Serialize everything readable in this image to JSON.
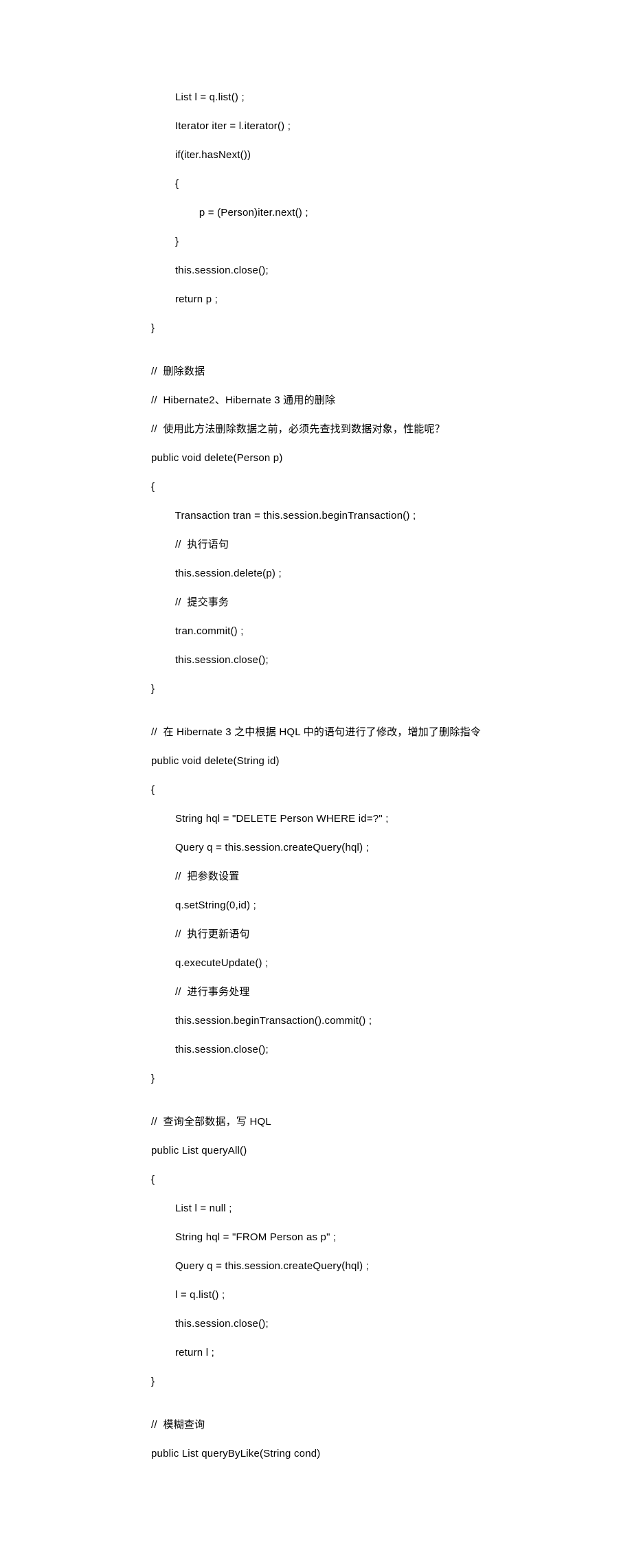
{
  "code": {
    "l01": "        List l = q.list() ;",
    "l02": "        Iterator iter = l.iterator() ;",
    "l03": "        if(iter.hasNext())",
    "l04": "        {",
    "l05": "                p = (Person)iter.next() ;",
    "l06": "        }",
    "l07": "        this.session.close();",
    "l08": "        return p ;",
    "l09": "}",
    "l10": "",
    "l11": "//  删除数据",
    "l12": "//  Hibernate2、Hibernate 3 通用的删除",
    "l13": "//  使用此方法删除数据之前，必须先查找到数据对象，性能呢？",
    "l14": "public void delete(Person p)",
    "l15": "{",
    "l16": "        Transaction tran = this.session.beginTransaction() ;",
    "l17": "        //  执行语句",
    "l18": "        this.session.delete(p) ;",
    "l19": "        //  提交事务",
    "l20": "        tran.commit() ;",
    "l21": "        this.session.close();",
    "l22": "}",
    "l23": "",
    "l24": "//  在 Hibernate 3 之中根据 HQL 中的语句进行了修改，增加了删除指令",
    "l25": "public void delete(String id)",
    "l26": "{",
    "l27": "        String hql = \"DELETE Person WHERE id=?\" ;",
    "l28": "        Query q = this.session.createQuery(hql) ;",
    "l29": "        //  把参数设置",
    "l30": "        q.setString(0,id) ;",
    "l31": "        //  执行更新语句",
    "l32": "        q.executeUpdate() ;",
    "l33": "        //  进行事务处理",
    "l34": "        this.session.beginTransaction().commit() ;",
    "l35": "        this.session.close();",
    "l36": "}",
    "l37": "",
    "l38": "//  查询全部数据，写 HQL",
    "l39": "public List queryAll()",
    "l40": "{",
    "l41": "        List l = null ;",
    "l42": "        String hql = \"FROM Person as p\" ;",
    "l43": "        Query q = this.session.createQuery(hql) ;",
    "l44": "        l = q.list() ;",
    "l45": "        this.session.close();",
    "l46": "        return l ;",
    "l47": "}",
    "l48": "",
    "l49": "//  模糊查询",
    "l50": "public List queryByLike(String cond)"
  }
}
